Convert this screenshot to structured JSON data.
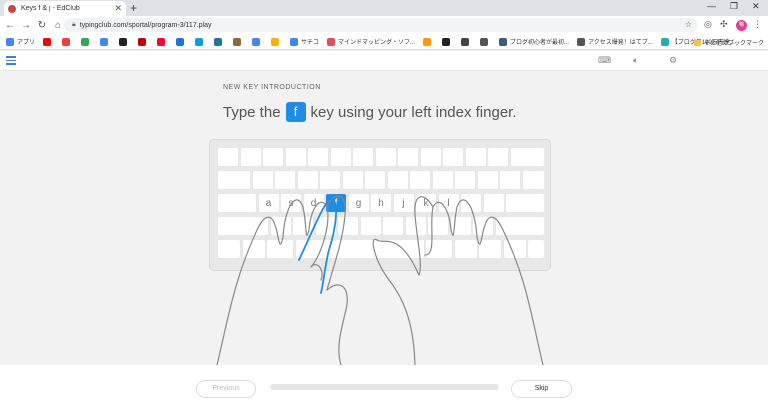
{
  "browser": {
    "tab_title": "Keys f & j - EdClub",
    "url": "typingclub.com/sportal/program-3/117.play",
    "profile": "鴨",
    "bookmarks": [
      {
        "label": "アプリ",
        "color": "#4285f4"
      },
      {
        "label": "",
        "color": "#ff0000"
      },
      {
        "label": "",
        "color": "#ea4335"
      },
      {
        "label": "",
        "color": "#34a853"
      },
      {
        "label": "",
        "color": "#4285f4"
      },
      {
        "label": "",
        "color": "#222222"
      },
      {
        "label": "",
        "color": "#bf0000"
      },
      {
        "label": "",
        "color": "#ff0033"
      },
      {
        "label": "",
        "color": "#1a73e8"
      },
      {
        "label": "",
        "color": "#00a1d6"
      },
      {
        "label": "",
        "color": "#21759b"
      },
      {
        "label": "",
        "color": "#8b6b3d"
      },
      {
        "label": "",
        "color": "#4285f4"
      },
      {
        "label": "",
        "color": "#f4b400"
      },
      {
        "label": "サチコ",
        "color": "#4285f4"
      },
      {
        "label": "マインドマッピング・ソフ...",
        "color": "#e84a5f"
      },
      {
        "label": "",
        "color": "#ff9900"
      },
      {
        "label": "",
        "color": "#222222"
      },
      {
        "label": "",
        "color": "#444444"
      },
      {
        "label": "",
        "color": "#555555"
      },
      {
        "label": "ブログ初心者が最初...",
        "color": "#3a5a80"
      },
      {
        "label": "アクセス爆発！はてブ...",
        "color": "#555555"
      },
      {
        "label": "【ブログ月100万円達...",
        "color": "#20b2aa"
      }
    ],
    "other_bookmarks": "その他のブックマーク"
  },
  "lesson": {
    "label": "NEW KEY INTRODUCTION",
    "instruction_before": "Type the",
    "target_key": "f",
    "instruction_after": "key using your left index finger."
  },
  "keyboard": {
    "home_keys": [
      "a",
      "s",
      "d",
      "f",
      "g",
      "h",
      "j",
      "k",
      "l"
    ]
  },
  "footer": {
    "previous_label": "Previous",
    "skip_label": "Skip",
    "progress": 0
  }
}
